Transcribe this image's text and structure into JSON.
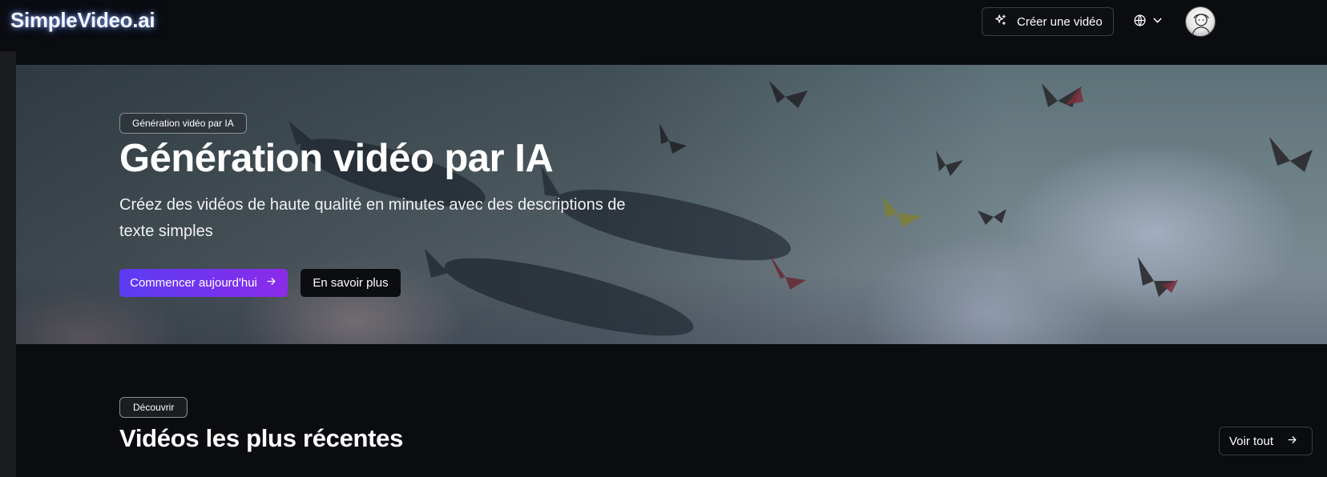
{
  "header": {
    "logo": "SimpleVideo.ai",
    "create_button": {
      "label": "Créer une vidéo",
      "icon": "sparkles-icon"
    },
    "language_menu": {
      "icon": "globe-icon",
      "chevron": "chevron-down-icon"
    },
    "avatar": {
      "icon": "user-avatar"
    }
  },
  "hero": {
    "badge": "Génération vidéo par IA",
    "title": "Génération vidéo par IA",
    "subtitle": "Créez des vidéos de haute qualité en minutes avec des descriptions de texte simples",
    "primary_button": {
      "label": "Commencer aujourd'hui",
      "icon": "arrow-right-icon"
    },
    "secondary_button": {
      "label": "En savoir plus"
    }
  },
  "recent_section": {
    "badge": "Découvrir",
    "title": "Vidéos les plus récentes",
    "see_all_button": {
      "label": "Voir tout",
      "icon": "arrow-right-icon"
    }
  },
  "colors": {
    "background": "#0a0c10",
    "primary_gradient_start": "#5b3cf2",
    "primary_gradient_end": "#8a2bea",
    "border": "#3a3d44"
  }
}
